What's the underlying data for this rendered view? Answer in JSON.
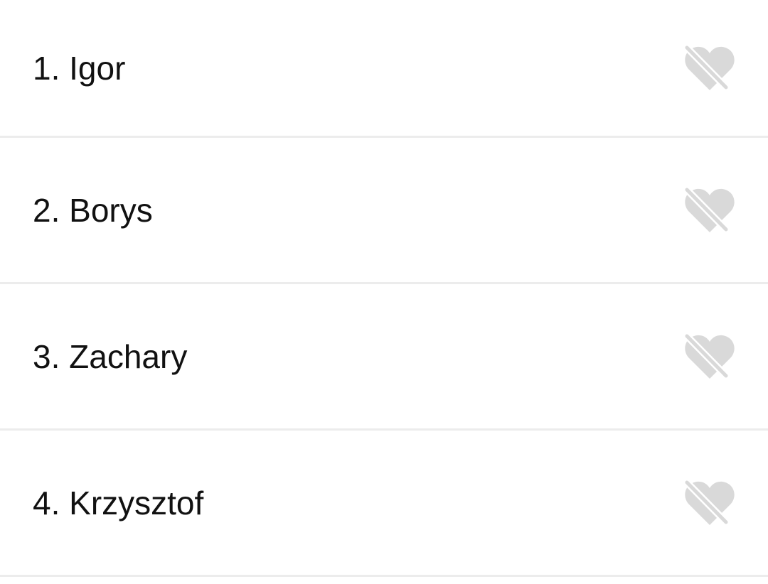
{
  "list": {
    "items": [
      {
        "number": "1",
        "name": "Igor",
        "icon": "heart-off-icon"
      },
      {
        "number": "2",
        "name": "Borys",
        "icon": "heart-off-icon"
      },
      {
        "number": "3",
        "name": "Zachary",
        "icon": "heart-off-icon"
      },
      {
        "number": "4",
        "name": "Krzysztof",
        "icon": "heart-off-icon"
      }
    ]
  },
  "colors": {
    "text": "#111111",
    "icon": "#d9d9d9",
    "divider": "#ececec",
    "background": "#ffffff"
  }
}
